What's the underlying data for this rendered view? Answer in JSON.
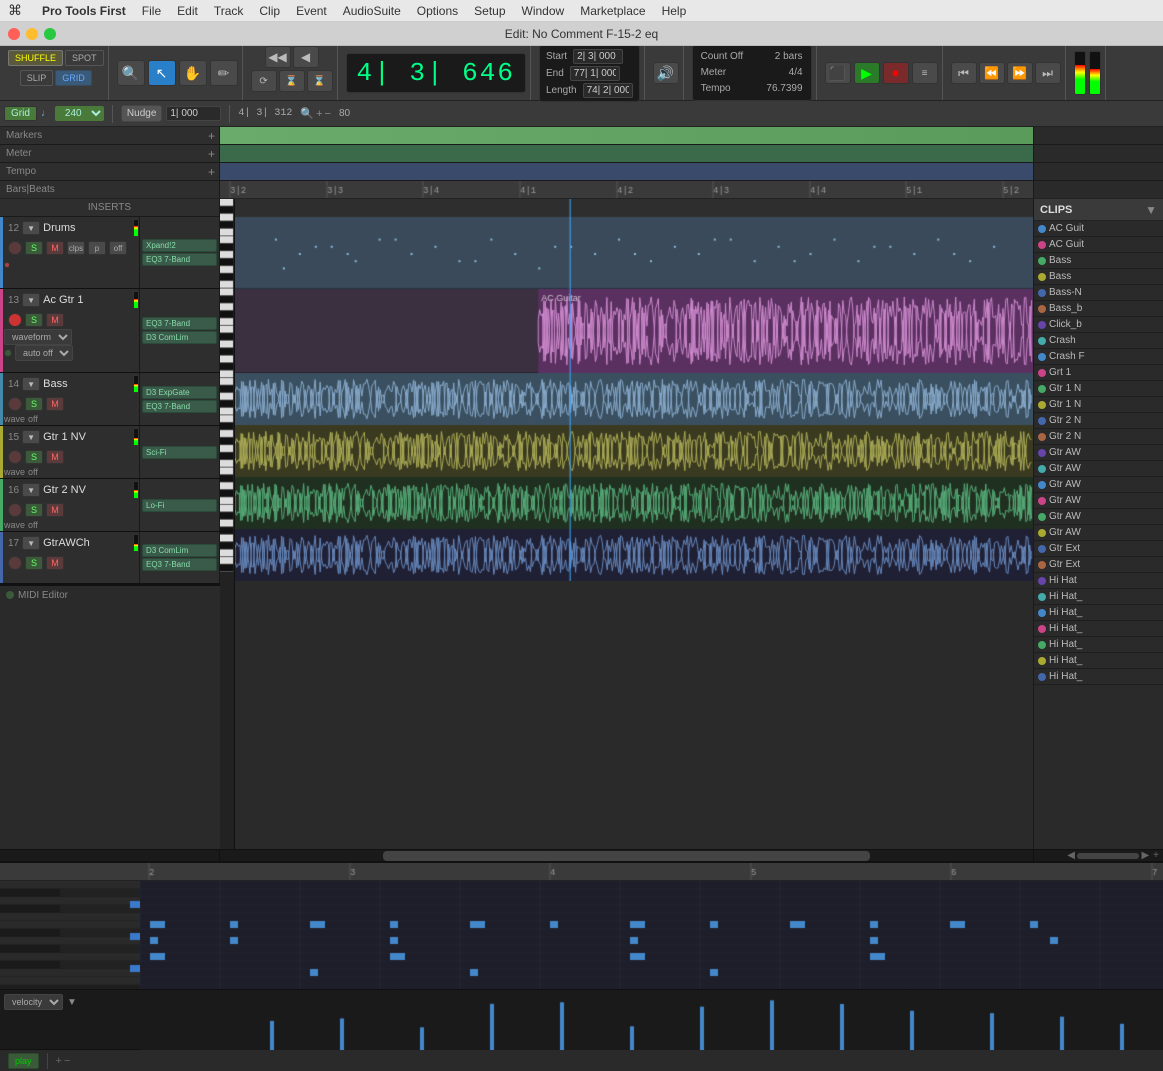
{
  "menubar": {
    "apple": "⌘",
    "appname": "Pro Tools First",
    "items": [
      "File",
      "Edit",
      "Track",
      "Clip",
      "Event",
      "AudioSuite",
      "Options",
      "Setup",
      "Window",
      "Marketplace",
      "Help"
    ]
  },
  "titlebar": {
    "title": "Edit: No Comment F-15-2 eq"
  },
  "toolbar": {
    "shuffle_label": "SHUFFLE",
    "spot_label": "SPOT",
    "slip_label": "SLIP",
    "grid_label": "GRID",
    "counter": "4| 3| 646",
    "start_label": "Start",
    "end_label": "End",
    "length_label": "Length",
    "start_val": "2| 3| 000",
    "end_val": "77| 1| 000",
    "length_val": "74| 2| 000",
    "count_off": "Count Off",
    "meter_label": "Meter",
    "tempo_label": "Tempo",
    "meter_val": "4/4",
    "tempo_val": "76.7399",
    "bars_label": "2 bars",
    "grid_label2": "Grid",
    "grid_val": "240",
    "nudge_label": "Nudge",
    "nudge_val": "1| 000",
    "counter2": "4| 3| 312",
    "zoom_val": "80"
  },
  "tracks": [
    {
      "num": "12",
      "name": "Drums",
      "color": "#4488cc",
      "inserts": [
        "Xpand!2",
        "EQ3 7-Band"
      ],
      "type": "midi"
    },
    {
      "num": "13",
      "name": "Ac Gtr 1",
      "color": "#cc4488",
      "inserts": [
        "EQ3 7-Band",
        "D3 ComLim"
      ],
      "type": "audio"
    },
    {
      "num": "14",
      "name": "Bass",
      "color": "#4488aa",
      "inserts": [
        "D3 ExpGate",
        "EQ3 7-Band"
      ],
      "type": "audio"
    },
    {
      "num": "15",
      "name": "Gtr 1 NV",
      "color": "#aaaa33",
      "inserts": [
        "Sci-Fi"
      ],
      "type": "audio"
    },
    {
      "num": "16",
      "name": "Gtr 2 NV",
      "color": "#44aa66",
      "inserts": [
        "Lo-Fi"
      ],
      "type": "audio"
    },
    {
      "num": "17",
      "name": "GtrAWCh",
      "color": "#4466aa",
      "inserts": [
        "D3 ComLim",
        "EQ3 7-Band"
      ],
      "type": "audio"
    }
  ],
  "clips_panel": {
    "title": "CLIPS",
    "items": [
      "AC Guit",
      "AC Guit",
      "Bass",
      "Bass",
      "Bass-N",
      "Bass_b",
      "Click_b",
      "Crash",
      "Crash F",
      "Grt 1",
      "Gtr 1 N",
      "Gtr 1 N",
      "Gtr 2 N",
      "Gtr 2 N",
      "Gtr AW",
      "Gtr AW",
      "Gtr AW",
      "Gtr AW",
      "Gtr AW",
      "Gtr AW",
      "Gtr Ext",
      "Gtr Ext",
      "Hi Hat",
      "Hi Hat_",
      "Hi Hat_",
      "Hi Hat_",
      "Hi Hat_",
      "Hi Hat_",
      "Hi Hat_"
    ]
  },
  "ruler": {
    "markers": [
      "3|2",
      "3|3",
      "3|4",
      "4|1",
      "4|2",
      "4|3",
      "4|4",
      "5|1",
      "5|2"
    ]
  },
  "bottom_ruler": {
    "markers": [
      "2",
      "3",
      "4",
      "5",
      "6",
      "7"
    ]
  },
  "midi_editor": {
    "label": "MIDI Editor",
    "velocity_label": "velocity"
  },
  "footer": {
    "play_label": "play"
  }
}
